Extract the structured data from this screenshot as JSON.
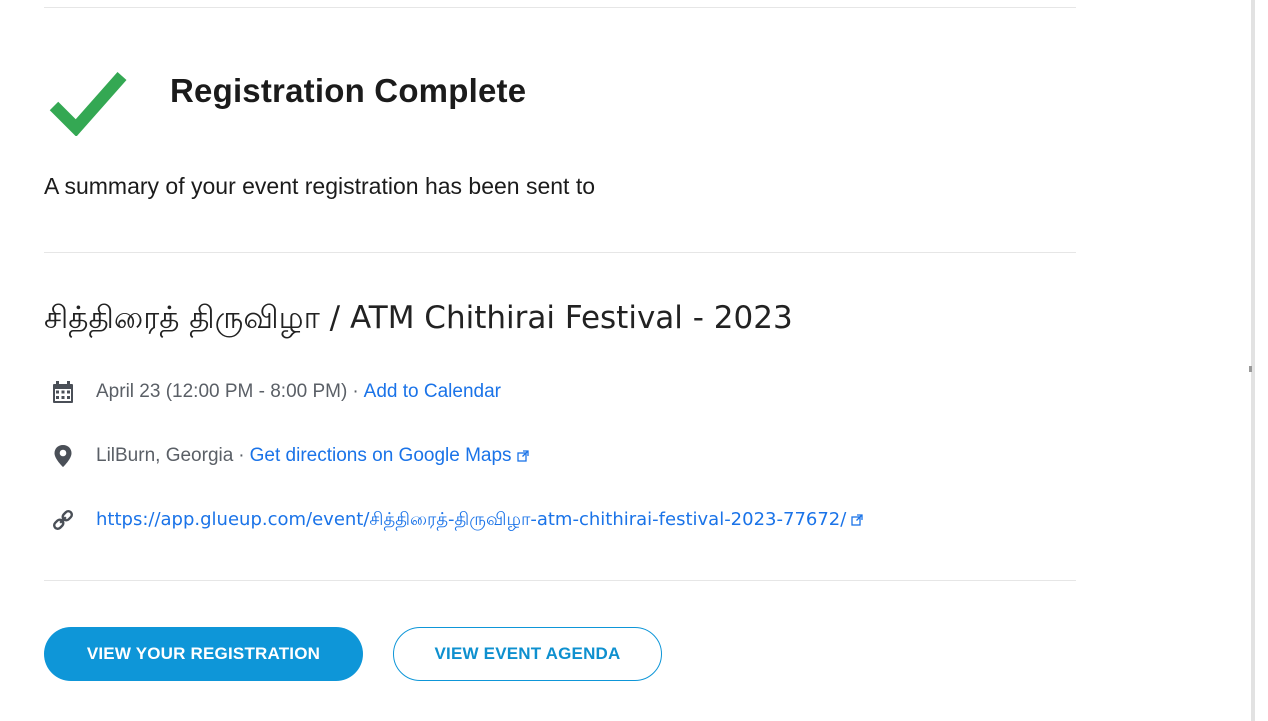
{
  "confirmation": {
    "title": "Registration Complete",
    "summary": "A summary of your event registration has been sent to"
  },
  "event": {
    "name": "சித்திரைத் திருவிழா / ATM Chithirai Festival - 2023",
    "date_time": "April 23 (12:00 PM - 8:00 PM)",
    "separator": "·",
    "add_to_calendar": "Add to Calendar",
    "location": "LilBurn, Georgia",
    "directions": "Get directions on Google Maps",
    "url": "https://app.glueup.com/event/சித்திரைத்-திருவிழா-atm-chithirai-festival-2023-77672/"
  },
  "buttons": {
    "view_registration": "VIEW YOUR REGISTRATION",
    "view_agenda": "VIEW EVENT AGENDA"
  },
  "colors": {
    "check": "#34a853",
    "link": "#1a73e8",
    "primary_button": "#0e96d8"
  },
  "icons": [
    "check-icon",
    "calendar-icon",
    "map-pin-icon",
    "link-icon",
    "external-link-icon"
  ]
}
